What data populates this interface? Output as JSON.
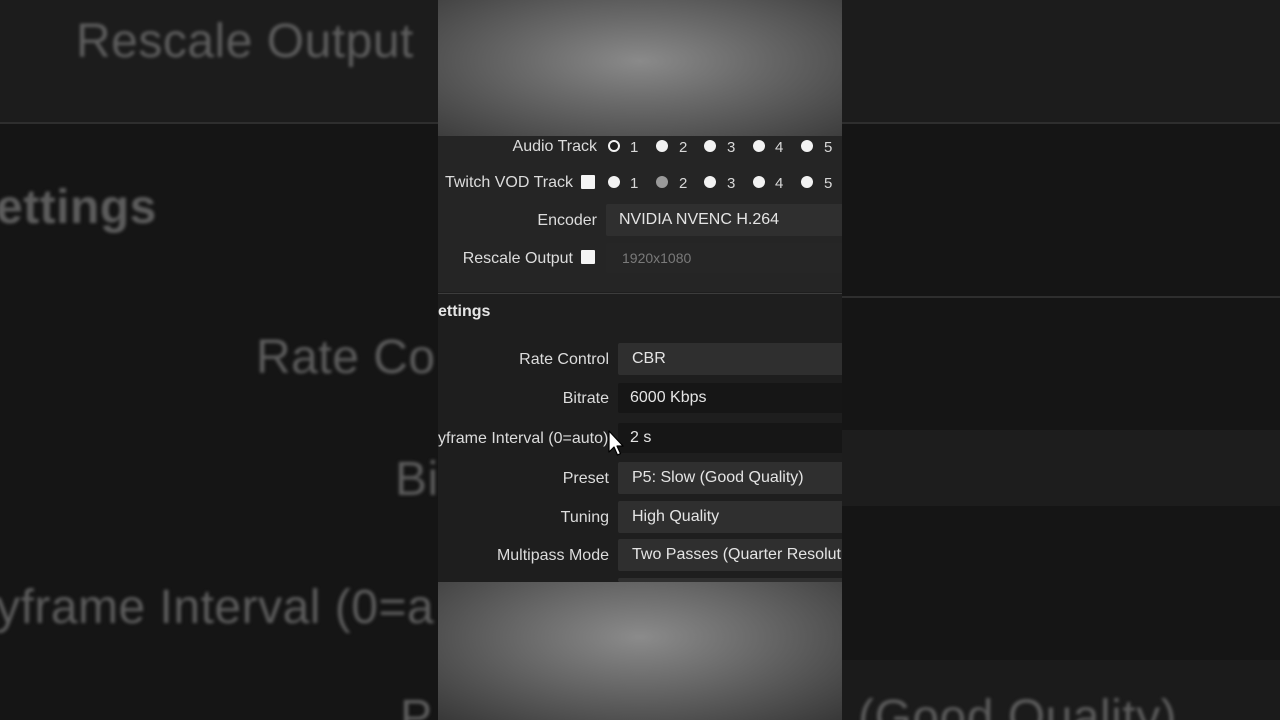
{
  "background": {
    "rescale_output": "Rescale Output",
    "settings": "ettings",
    "rate_control": "Rate Co",
    "bitrate": "Bi",
    "keyframe": "yframe Interval (0=a",
    "bottom_left": "P",
    "bottom_right": "(Good Quality)"
  },
  "output": {
    "audio_track_label": "Audio Track",
    "twitch_vod_label": "Twitch VOD Track",
    "tracks": [
      "1",
      "2",
      "3",
      "4",
      "5"
    ],
    "encoder_label": "Encoder",
    "encoder_value": "NVIDIA NVENC H.264",
    "rescale_label": "Rescale Output",
    "rescale_value": "1920x1080"
  },
  "encoder_settings": {
    "title": "ettings",
    "rate_control_label": "Rate Control",
    "rate_control_value": "CBR",
    "bitrate_label": "Bitrate",
    "bitrate_value": "6000 Kbps",
    "keyframe_label": "yframe Interval (0=auto)",
    "keyframe_value": "2 s",
    "preset_label": "Preset",
    "preset_value": "P5: Slow (Good Quality)",
    "tuning_label": "Tuning",
    "tuning_value": "High Quality",
    "multipass_label": "Multipass Mode",
    "multipass_value": "Two Passes (Quarter Resolutio"
  },
  "icons": {
    "cursor": "mouse-pointer-icon",
    "radio_selected": "radio-selected-icon",
    "radio": "radio-icon",
    "checkbox": "checkbox-icon"
  },
  "colors": {
    "panel": "#1e1e1e",
    "field": "#2f2f2f",
    "text": "#dcdcdc"
  }
}
